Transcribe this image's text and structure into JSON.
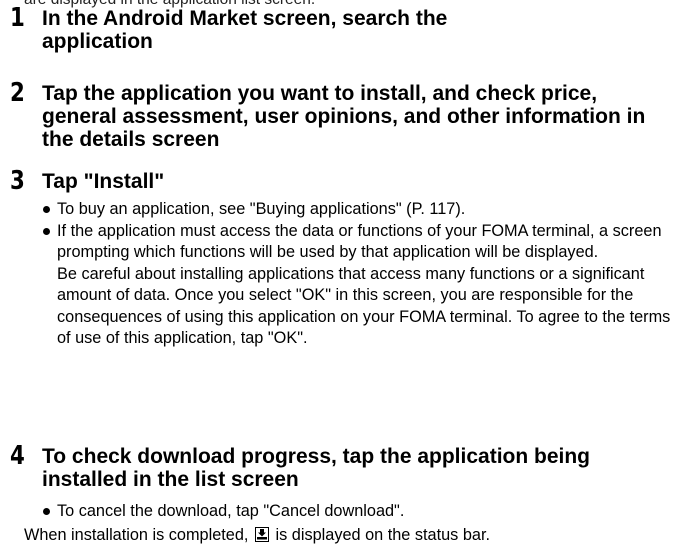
{
  "header": {
    "top_line": "are displayed in the application list screen."
  },
  "steps": [
    {
      "number": "1",
      "title": "In the Android Market screen, search the application"
    },
    {
      "number": "2",
      "title": "Tap the application you want to install, and check price, general assessment, user opinions, and other information in the details screen"
    },
    {
      "number": "3",
      "title": "Tap \"Install\"",
      "bullets": [
        "To buy an application, see \"Buying applications\" (P. 117).",
        "If the application must access the data or functions of your FOMA terminal, a screen prompting which functions will be used by that application will be displayed."
      ],
      "note": "Be careful about installing applications that access many functions or a significant amount of data. Once you select \"OK\" in this screen, you are responsible for the consequences of using this application on your FOMA terminal. To agree to the terms of use of this application, tap \"OK\"."
    },
    {
      "number": "4",
      "title": "To check download progress, tap the application being installed in the list screen",
      "bullets": [
        "To cancel the download, tap \"Cancel download\"."
      ]
    }
  ],
  "footer": {
    "text_before_icon": "When installation is completed,",
    "icon": "download-complete-icon",
    "text_after_icon": "is displayed on the status bar."
  }
}
